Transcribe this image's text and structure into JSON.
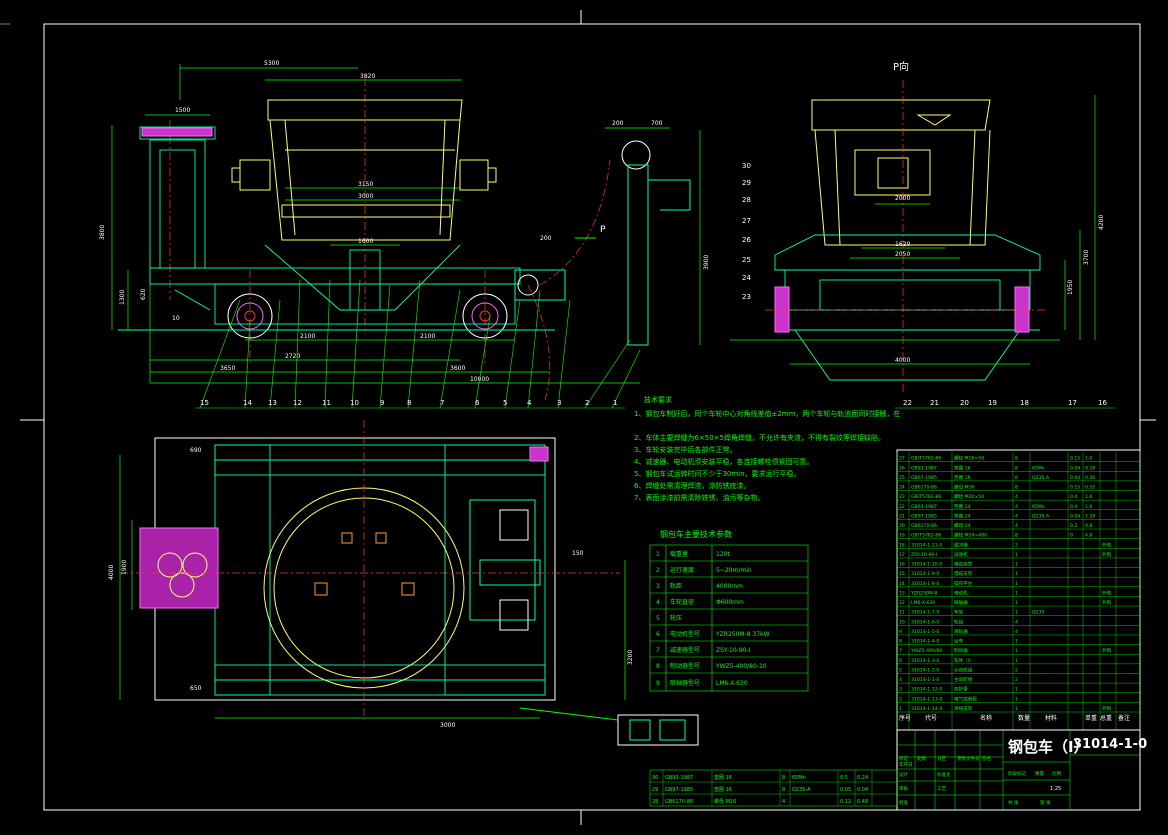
{
  "drawing": {
    "view_label": "P向",
    "drawing_title": "钢包车（I）",
    "drawing_number": "31014-1-0",
    "company": "",
    "colors": {
      "background": "#000000",
      "frame": "#ffffff",
      "outline": "#ffff66",
      "dims": "#00ff00",
      "centerline": "#ff3333",
      "magenta": "#ff33ff",
      "cyan": "#00ffff",
      "text": "#ffffff"
    }
  },
  "dimensions": {
    "front_view": [
      "5300",
      "3820",
      "1500",
      "3150",
      "3000",
      "1600",
      "2100",
      "2100",
      "2720",
      "3650",
      "3600",
      "10000",
      "3800",
      "1300",
      "620",
      "200",
      "10",
      "P"
    ],
    "right_view": [
      "2000",
      "1620",
      "2050",
      "4000",
      "4200",
      "3700",
      "1950",
      "200",
      "700",
      "3900"
    ],
    "plan_view": [
      "4000",
      "1900",
      "3000",
      "3200",
      "690",
      "650",
      "150"
    ]
  },
  "tech_requirements": {
    "title": "技术要求",
    "items": [
      "1、钢包车制好后，同个车轮中心对角线差值±2mm，两个车轮与轨道面同时接触，在",
      "2、车体主要焊缝为6×50×5焊角焊缝，不允许有夹渣，不得有裂纹等焊接缺陷。",
      "3、车轮安装完毕后各部件正常。",
      "4、减速器、电动机须安装平稳，各连接螺栓须紧固可靠。",
      "5、钢包车试运转时间不少于30min，要求运行平稳。",
      "6、焊缝处需清理焊渣，涂防锈底漆。",
      "7、表面涂漆前需清除铁锈、油污等杂物。"
    ]
  },
  "param_table": {
    "title": "钢包车主要技术参数",
    "rows": [
      [
        "1",
        "载重量",
        "120t"
      ],
      [
        "2",
        "运行速度",
        "5~20m/min"
      ],
      [
        "3",
        "轨距",
        "4000mm"
      ],
      [
        "4",
        "车轮直径",
        "Φ600mm"
      ],
      [
        "5",
        "轮压",
        ""
      ],
      [
        "6",
        "电动机型号",
        "YZR250M-8  37kW"
      ],
      [
        "7",
        "减速器型号",
        "ZSY-10-90-I"
      ],
      [
        "8",
        "制动器型号",
        "YWZ5-400/80-10"
      ],
      [
        "9",
        "联轴器型号",
        "LM6-X-630"
      ]
    ]
  },
  "bom": {
    "header": [
      "序号",
      "代号",
      "名称",
      "数量",
      "材料",
      "单重",
      "总重",
      "备注"
    ],
    "rows": [
      [
        "27",
        "GB/T5782-86",
        "螺栓 M16×50",
        "8",
        "",
        "0.15",
        "1.0",
        ""
      ],
      [
        "26",
        "GB93-1987",
        "垫圈 16",
        "8",
        "65Mn",
        "0.04",
        "0.18",
        ""
      ],
      [
        "25",
        "GB97-1985",
        "垫圈 16",
        "8",
        "Q235-A",
        "0.04",
        "0.36",
        ""
      ],
      [
        "24",
        "GB6170-86",
        "螺母 M16",
        "8",
        "",
        "0.15",
        "0.52",
        ""
      ],
      [
        "23",
        "GB/T5782-86",
        "螺栓 M20×50",
        "4",
        "",
        "0.4",
        "1.6",
        ""
      ],
      [
        "22",
        "GB93-1987",
        "垫圈 24",
        "4",
        "65Mn",
        "0.4",
        "1.6",
        ""
      ],
      [
        "21",
        "GB97-1985",
        "垫圈 24",
        "4",
        "Q235-A",
        "0.04",
        "1.28",
        ""
      ],
      [
        "20",
        "GB6170-86",
        "螺母 24",
        "4",
        "",
        "0.2",
        "0.8",
        ""
      ],
      [
        "19",
        "GB/T5782-86",
        "螺栓 M24×400",
        "8",
        "",
        "0",
        "4.8",
        ""
      ],
      [
        "18",
        "31014-1-11-0",
        "缓冲器",
        "2",
        "",
        "",
        "",
        "外购"
      ],
      [
        "17",
        "ZSY-10-90-I",
        "减速机",
        "1",
        "",
        "",
        "",
        "外购"
      ],
      [
        "16",
        "31014-1-10-0",
        "电缆卷筒",
        "1",
        "",
        "",
        "",
        ""
      ],
      [
        "15",
        "31014-1-9-0",
        "电缆支架",
        "1",
        "",
        "",
        "",
        ""
      ],
      [
        "14",
        "31014-1-8-0",
        "操作平台",
        "1",
        "",
        "",
        "",
        ""
      ],
      [
        "13",
        "YZR250M-8",
        "电动机",
        "1",
        "",
        "",
        "",
        "外购"
      ],
      [
        "12",
        "LM6-X-630",
        "联轴器",
        "1",
        "",
        "",
        "",
        "外购"
      ],
      [
        "11",
        "31014-1-7-0",
        "车架",
        "1",
        "Q235",
        "",
        "",
        ""
      ],
      [
        "10",
        "31014-1-6-0",
        "轮组",
        "4",
        "",
        "",
        "",
        ""
      ],
      [
        "9",
        "31014-1-5-0",
        "清轨器",
        "4",
        "",
        "",
        "",
        ""
      ],
      [
        "8",
        "31014-1-4-0",
        "台车",
        "1",
        "",
        "",
        "",
        ""
      ],
      [
        "7",
        "YWZ5-400/80",
        "制动器",
        "1",
        "",
        "",
        "",
        "外购"
      ],
      [
        "6",
        "31014-1-3-0",
        "车体（I）",
        "1",
        "",
        "",
        "",
        ""
      ],
      [
        "5",
        "31014-1-2-0",
        "从动轮组",
        "2",
        "",
        "",
        "",
        ""
      ],
      [
        "4",
        "31014-1-1-0",
        "主动轮组",
        "2",
        "",
        "",
        "",
        ""
      ],
      [
        "3",
        "31014-1-12-0",
        "防护罩",
        "1",
        "",
        "",
        "",
        ""
      ],
      [
        "2",
        "31014-1-13-0",
        "电气控制柜",
        "1",
        "",
        "",
        "",
        ""
      ],
      [
        "1",
        "31014-1-14-0",
        "滑线支架",
        "1",
        "",
        "",
        "",
        "外购"
      ]
    ]
  },
  "small_bom": {
    "rows": [
      [
        "30",
        "GB93-1987",
        "垫圈 16",
        "8",
        "65Mn",
        "0.5",
        "0.24"
      ],
      [
        "29",
        "GB97-1985",
        "垫圈 16",
        "8",
        "Q235-A",
        "0.05",
        "0.04"
      ],
      [
        "28",
        "GB6170-86",
        "螺母 M16",
        "4",
        "",
        "0.12",
        "0.48"
      ]
    ]
  },
  "title_block": {
    "labels": [
      "标记",
      "处数",
      "分区",
      "更改文件号",
      "签名",
      "年月日",
      "设计",
      "标准化",
      "审核",
      "工艺",
      "批准",
      "阶段标记",
      "重量",
      "比例",
      "共 张",
      "第 张"
    ],
    "scale": "1:25"
  },
  "part_numbers": {
    "front": [
      "15",
      "14",
      "13",
      "12",
      "11",
      "10",
      "9",
      "8",
      "7",
      "6",
      "5",
      "4",
      "3",
      "2",
      "1"
    ],
    "side_left": [
      "30",
      "29",
      "28",
      "27",
      "26",
      "25",
      "24",
      "23"
    ],
    "side_bottom": [
      "22",
      "21",
      "20",
      "19",
      "18",
      "17",
      "16"
    ]
  }
}
